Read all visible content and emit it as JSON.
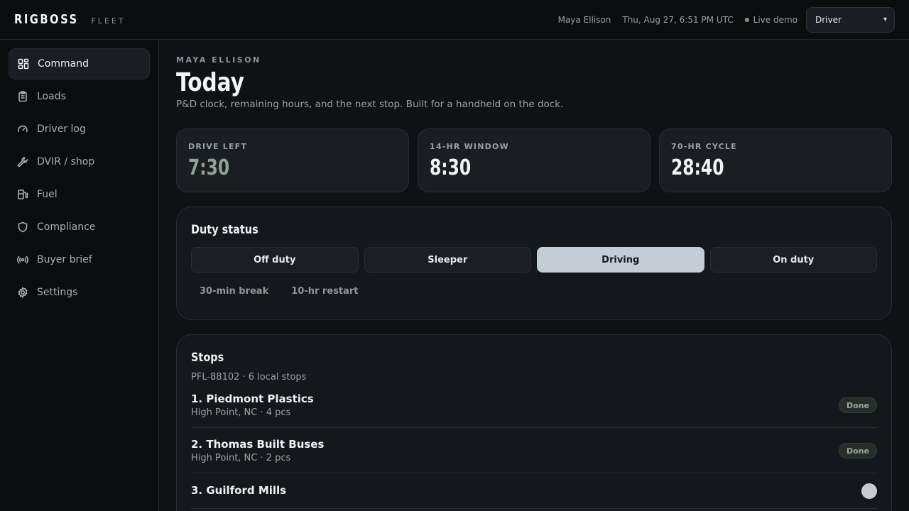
{
  "brand": {
    "name": "RIGBOSS",
    "sub": "FLEET"
  },
  "header": {
    "user": "Maya Ellison",
    "datetime": "Thu, Aug 27, 6:51 PM UTC",
    "live": "Live demo",
    "role_select": {
      "value": "Driver"
    }
  },
  "sidebar": {
    "items": [
      {
        "label": "Command",
        "icon": "grid-icon"
      },
      {
        "label": "Loads",
        "icon": "clipboard-icon"
      },
      {
        "label": "Driver log",
        "icon": "gauge-icon"
      },
      {
        "label": "DVIR / shop",
        "icon": "wrench-icon"
      },
      {
        "label": "Fuel",
        "icon": "fuel-icon"
      },
      {
        "label": "Compliance",
        "icon": "shield-icon"
      },
      {
        "label": "Buyer brief",
        "icon": "broadcast-icon"
      },
      {
        "label": "Settings",
        "icon": "gear-icon"
      }
    ]
  },
  "main": {
    "eyebrow": "MAYA ELLISON",
    "title": "Today",
    "subtitle": "P&D clock, remaining hours, and the next stop. Built for a handheld on the dock.",
    "stats": [
      {
        "label": "DRIVE LEFT",
        "value": "7:30"
      },
      {
        "label": "14-HR WINDOW",
        "value": "8:30"
      },
      {
        "label": "70-HR CYCLE",
        "value": "28:40"
      }
    ],
    "duty": {
      "title": "Duty status",
      "options": [
        "Off duty",
        "Sleeper",
        "Driving",
        "On duty"
      ],
      "selected": "Driving",
      "extras": [
        "30-min break",
        "10-hr restart"
      ]
    },
    "stops": {
      "title": "Stops",
      "subtitle": "PFL-88102 · 6 local stops",
      "items": [
        {
          "name": "1. Piedmont Plastics",
          "meta": "High Point, NC · 4 pcs",
          "status": "Done"
        },
        {
          "name": "2. Thomas Built Buses",
          "meta": "High Point, NC · 2 pcs",
          "status": "Done"
        },
        {
          "name": "3. Guilford Mills",
          "meta": "",
          "status": ""
        }
      ]
    }
  },
  "colors": {
    "accent": "#8ea392",
    "active_button": "#c5ccd4",
    "background": "#0f1114"
  }
}
